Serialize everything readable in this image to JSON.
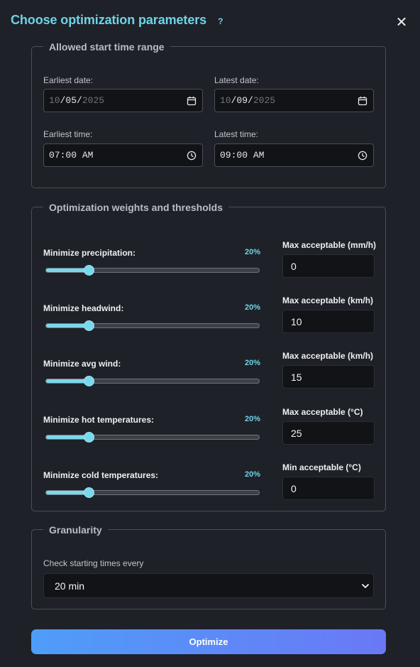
{
  "dialog": {
    "title": "Choose optimization parameters",
    "help": "?",
    "close_icon": "close-icon"
  },
  "start_range": {
    "legend": "Allowed start time range",
    "earliest_date": {
      "label": "Earliest date:",
      "month": "10",
      "day": "05",
      "year": "2025",
      "icon": "calendar-icon"
    },
    "latest_date": {
      "label": "Latest date:",
      "month": "10",
      "day": "09",
      "year": "2025",
      "icon": "calendar-icon"
    },
    "earliest_time": {
      "label": "Earliest time:",
      "hour": "07",
      "minute": "00",
      "ampm": "AM",
      "icon": "clock-icon"
    },
    "latest_time": {
      "label": "Latest time:",
      "hour": "09",
      "minute": "00",
      "ampm": "AM",
      "icon": "clock-icon"
    }
  },
  "weights": {
    "legend": "Optimization weights and thresholds",
    "rows": [
      {
        "label": "Minimize precipitation:",
        "percent": "20%",
        "weight": 0.2,
        "threshold_label": "Max acceptable (mm/h)",
        "threshold": "0"
      },
      {
        "label": "Minimize headwind:",
        "percent": "20%",
        "weight": 0.2,
        "threshold_label": "Max acceptable (km/h)",
        "threshold": "10"
      },
      {
        "label": "Minimize avg wind:",
        "percent": "20%",
        "weight": 0.2,
        "threshold_label": "Max acceptable (km/h)",
        "threshold": "15"
      },
      {
        "label": "Minimize hot temperatures:",
        "percent": "20%",
        "weight": 0.2,
        "threshold_label": "Max acceptable (°C)",
        "threshold": "25"
      },
      {
        "label": "Minimize cold temperatures:",
        "percent": "20%",
        "weight": 0.2,
        "threshold_label": "Min acceptable (°C)",
        "threshold": "0"
      }
    ]
  },
  "granularity": {
    "legend": "Granularity",
    "label": "Check starting times every",
    "selected": "20 min",
    "icon": "chevron-down-icon"
  },
  "actions": {
    "optimize": "Optimize"
  },
  "colors": {
    "accent": "#6fd3e8",
    "button_start": "#4f9df9",
    "button_end": "#6a78f5",
    "background": "#1e2127"
  }
}
